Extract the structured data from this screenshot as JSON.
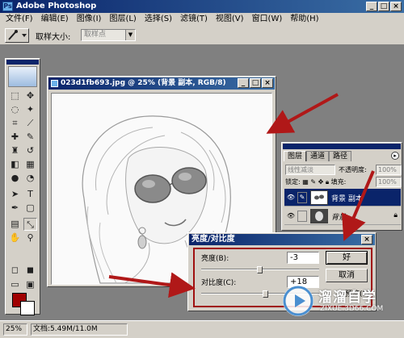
{
  "app": {
    "title": "Adobe Photoshop",
    "logo_text": "Ps"
  },
  "menu": [
    {
      "label": "文件(F)"
    },
    {
      "label": "编辑(E)"
    },
    {
      "label": "图像(I)"
    },
    {
      "label": "图层(L)"
    },
    {
      "label": "选择(S)"
    },
    {
      "label": "滤镜(T)"
    },
    {
      "label": "视图(V)"
    },
    {
      "label": "窗口(W)"
    },
    {
      "label": "帮助(H)"
    }
  ],
  "options_bar": {
    "sample_size_label": "取样大小:",
    "sample_size_value": "取样点"
  },
  "document": {
    "title": "023d1fb693.jpg @ 25% (背景 副本, RGB/8)"
  },
  "layers_panel": {
    "tabs": [
      "图层",
      "通道",
      "路径"
    ],
    "blend_mode": "线性减淡",
    "opacity_label": "不透明度:",
    "opacity_value": "100%",
    "lock_label": "锁定:",
    "fill_label": "填充:",
    "fill_value": "100%",
    "layers": [
      {
        "name": "背景 副本",
        "selected": true
      },
      {
        "name": "背景",
        "selected": false
      }
    ]
  },
  "dialog": {
    "title": "亮度/对比度",
    "brightness_label": "亮度(B):",
    "brightness_value": "-3",
    "brightness_level": 0.49,
    "contrast_label": "对比度(C):",
    "contrast_value": "+18",
    "contrast_level": 0.54,
    "ok_label": "好",
    "cancel_label": "取消",
    "preview_label": "预览(P)",
    "preview_checked": true
  },
  "status_bar": {
    "zoom": "25%",
    "doc_info": "文档:5.49M/11.0M"
  },
  "watermark": {
    "name": "溜溜自学",
    "url": "ZIXUE.3D66.COM"
  },
  "colors": {
    "foreground": "#a00000",
    "background": "#ffffff",
    "annotation_arrow": "#b01818"
  }
}
